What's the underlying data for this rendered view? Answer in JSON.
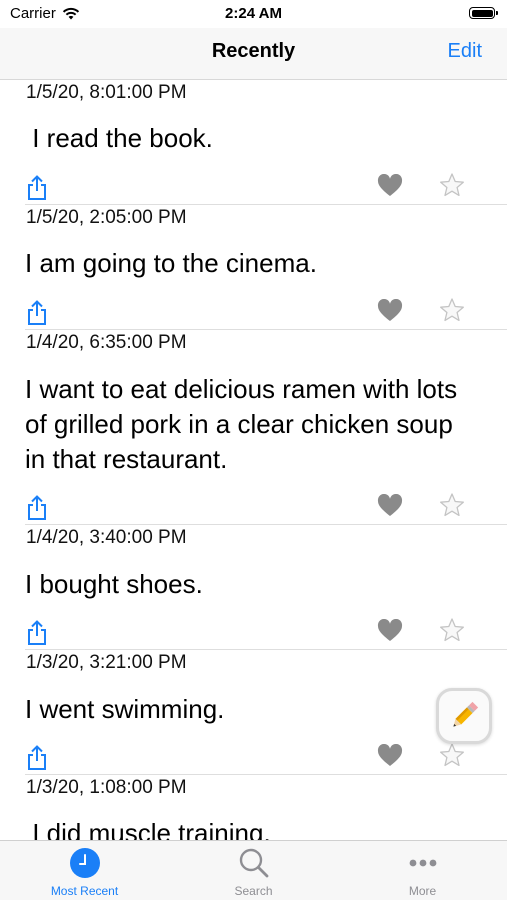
{
  "status": {
    "carrier": "Carrier",
    "time": "2:24 AM"
  },
  "nav": {
    "title": "Recently",
    "edit_label": "Edit"
  },
  "entries": [
    {
      "date": "1/5/20, 8:01:00 PM",
      "text": " I read the book."
    },
    {
      "date": "1/5/20, 2:05:00 PM",
      "text": "I am going to the cinema."
    },
    {
      "date": "1/4/20, 6:35:00 PM",
      "text": "I want to eat delicious ramen with lots of grilled pork in a clear chicken soup in that restaurant."
    },
    {
      "date": "1/4/20, 3:40:00 PM",
      "text": "I bought shoes."
    },
    {
      "date": "1/3/20, 3:21:00 PM",
      "text": "I went swimming."
    },
    {
      "date": "1/3/20, 1:08:00 PM",
      "text": " I did muscle training."
    }
  ],
  "icons": {
    "share": "share-icon",
    "heart": "gray-heart-icon",
    "star": "star-outline-icon",
    "compose": "pencil-icon"
  },
  "tabs": [
    {
      "label": "Most Recent",
      "icon": "clock-icon",
      "active": true
    },
    {
      "label": "Search",
      "icon": "search-icon",
      "active": false
    },
    {
      "label": "More",
      "icon": "more-icon",
      "active": false
    }
  ],
  "colors": {
    "accent": "#1a7ff7",
    "inactive": "#8e8e93",
    "heart": "#8a8a8a"
  }
}
